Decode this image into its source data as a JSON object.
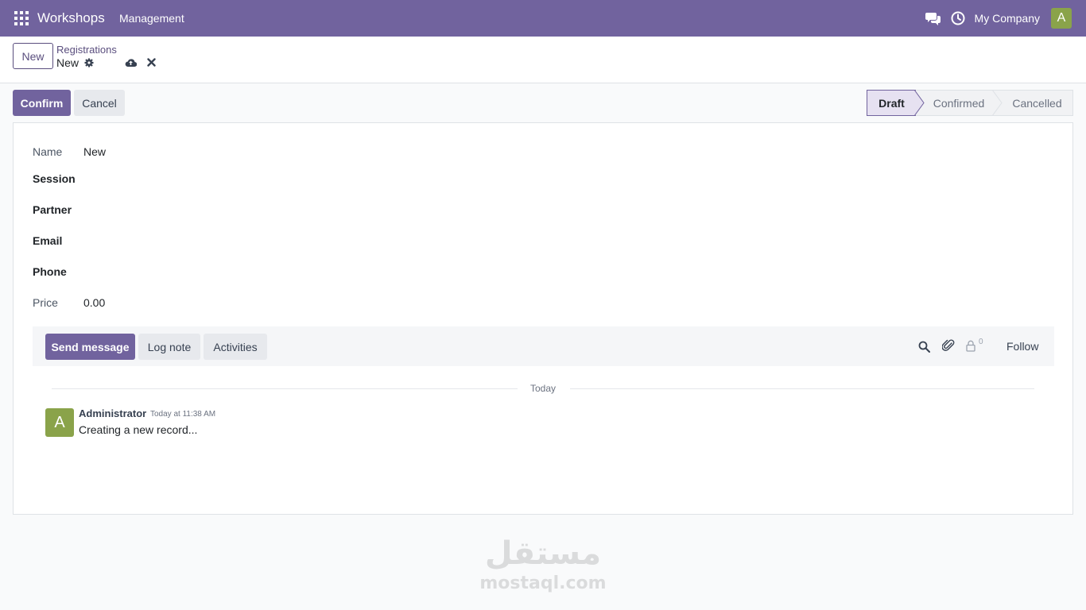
{
  "navbar": {
    "app_title": "Workshops",
    "menu": [
      "Management"
    ],
    "company": "My Company",
    "user_initial": "A"
  },
  "control_panel": {
    "new_label": "New",
    "breadcrumb_parent": "Registrations",
    "breadcrumb_current": "New"
  },
  "actions": {
    "confirm_label": "Confirm",
    "cancel_label": "Cancel"
  },
  "statusbar": {
    "stages": [
      "Draft",
      "Confirmed",
      "Cancelled"
    ],
    "active": "Draft"
  },
  "form": {
    "name_label": "Name",
    "name_value": "New",
    "session_label": "Session",
    "partner_label": "Partner",
    "email_label": "Email",
    "phone_label": "Phone",
    "price_label": "Price",
    "price_value": "0.00"
  },
  "chatter": {
    "send_message_label": "Send message",
    "log_note_label": "Log note",
    "activities_label": "Activities",
    "follower_count": "0",
    "follow_label": "Follow",
    "date_separator": "Today",
    "messages": [
      {
        "author": "Administrator",
        "author_initial": "A",
        "date": "Today at 11:38 AM",
        "body": "Creating a new record..."
      }
    ]
  },
  "watermark": {
    "arabic": "مستقل",
    "latin": "mostaql.com"
  },
  "colors": {
    "brand": "#71639e",
    "avatar": "#8aa34a"
  }
}
